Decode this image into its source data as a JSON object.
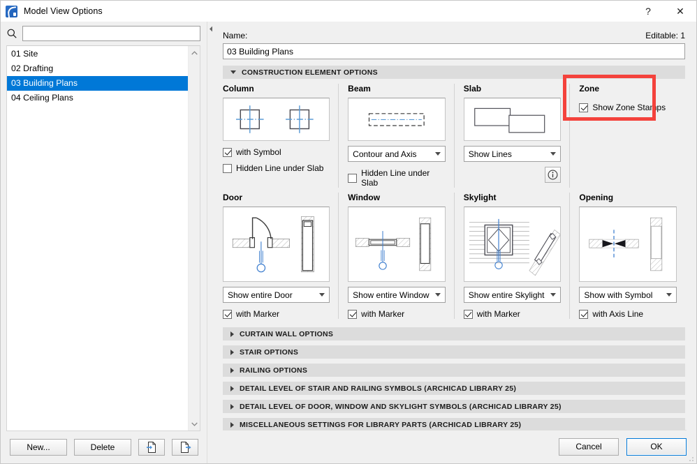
{
  "window": {
    "title": "Model View Options",
    "app_icon": "archicad-logo-icon",
    "help_btn": "?",
    "close_btn": "✕"
  },
  "sidebar": {
    "search_placeholder": "",
    "search_value": "",
    "search_icon": "search-icon",
    "items": [
      {
        "label": "01 Site",
        "selected": false
      },
      {
        "label": "02 Drafting",
        "selected": false
      },
      {
        "label": "03 Building Plans",
        "selected": true
      },
      {
        "label": "04 Ceiling Plans",
        "selected": false
      }
    ],
    "buttons": {
      "new": "New...",
      "delete": "Delete",
      "import_icon": "import-document-icon",
      "export_icon": "export-document-icon"
    }
  },
  "main": {
    "name_label": "Name:",
    "editable_label": "Editable: 1",
    "name_value": "03 Building Plans",
    "sections": {
      "construction": "CONSTRUCTION ELEMENT OPTIONS",
      "collapsed": [
        "CURTAIN WALL OPTIONS",
        "STAIR OPTIONS",
        "RAILING OPTIONS",
        "DETAIL LEVEL OF STAIR AND RAILING SYMBOLS (ARCHICAD LIBRARY 25)",
        "DETAIL LEVEL OF DOOR, WINDOW AND SKYLIGHT SYMBOLS (ARCHICAD LIBRARY 25)",
        "MISCELLANEOUS SETTINGS FOR LIBRARY PARTS (ARCHICAD LIBRARY 25)"
      ]
    },
    "elements": {
      "column": {
        "title": "Column",
        "check1": {
          "label": "with Symbol",
          "checked": true
        },
        "check2": {
          "label": "Hidden Line under Slab",
          "checked": false
        }
      },
      "beam": {
        "title": "Beam",
        "select": "Contour and Axis",
        "check": {
          "label": "Hidden Line under Slab",
          "checked": false
        }
      },
      "slab": {
        "title": "Slab",
        "select": "Show Lines",
        "info_icon": "info-icon"
      },
      "zone": {
        "title": "Zone",
        "check": {
          "label": "Show Zone Stamps",
          "checked": true
        },
        "highlight_color": "#f4423c"
      },
      "door": {
        "title": "Door",
        "select": "Show entire Door",
        "check": {
          "label": "with Marker",
          "checked": true
        }
      },
      "window": {
        "title": "Window",
        "select": "Show entire Window",
        "check": {
          "label": "with Marker",
          "checked": true
        }
      },
      "skylight": {
        "title": "Skylight",
        "select": "Show entire Skylight",
        "check": {
          "label": "with Marker",
          "checked": true
        }
      },
      "opening": {
        "title": "Opening",
        "select": "Show with Symbol",
        "check": {
          "label": "with Axis Line",
          "checked": true
        }
      }
    }
  },
  "footer": {
    "cancel": "Cancel",
    "ok": "OK"
  },
  "colors": {
    "selection_blue": "#0078d7",
    "accent_blue": "#4a90d9",
    "highlight_red": "#f4423c",
    "section_bg": "#dcdcdc",
    "dialog_bg": "#f0f0f0"
  }
}
